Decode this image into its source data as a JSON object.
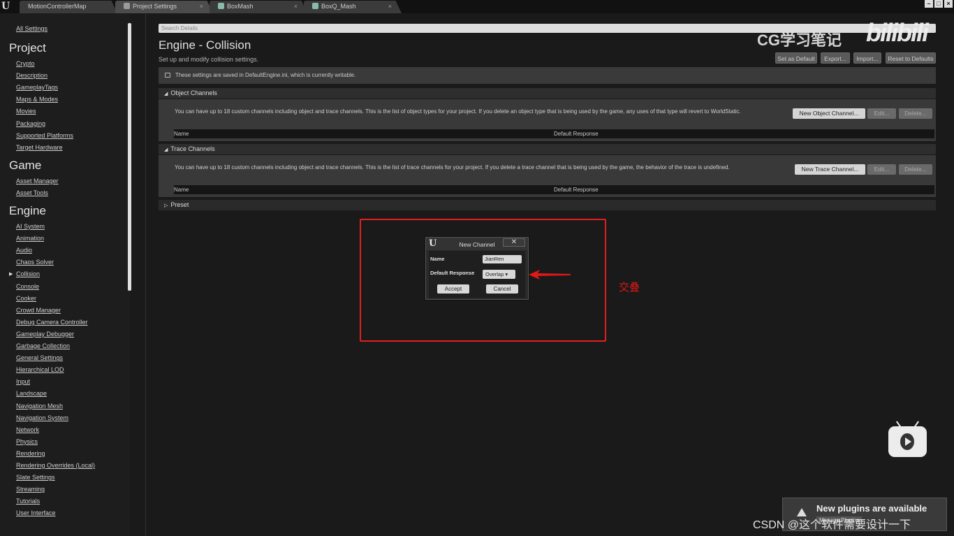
{
  "tabs": [
    {
      "label": "MotionControllerMap",
      "active": false
    },
    {
      "label": "Project Settings",
      "active": true
    },
    {
      "label": "BoxMash",
      "active": false
    },
    {
      "label": "BoxQ_Mash",
      "active": false
    }
  ],
  "window_buttons": [
    "–",
    "□",
    "×"
  ],
  "sidebar": {
    "all_settings": "All Settings",
    "project_heading": "Project",
    "project_items": [
      "Crypto",
      "Description",
      "GameplayTags",
      "Maps & Modes",
      "Movies",
      "Packaging",
      "Supported Platforms",
      "Target Hardware"
    ],
    "game_heading": "Game",
    "game_items": [
      "Asset Manager",
      "Asset Tools"
    ],
    "engine_heading": "Engine",
    "engine_items": [
      "AI System",
      "Animation",
      "Audio",
      "Chaos Solver",
      "Collision",
      "Console",
      "Cooker",
      "Crowd Manager",
      "Debug Camera Controller",
      "Gameplay Debugger",
      "Garbage Collection",
      "General Settings",
      "Hierarchical LOD",
      "Input",
      "Landscape",
      "Navigation Mesh",
      "Navigation System",
      "Network",
      "Physics",
      "Rendering",
      "Rendering Overrides (Local)",
      "Slate Settings",
      "Streaming",
      "Tutorials",
      "User Interface"
    ],
    "selected": "Collision"
  },
  "search": {
    "placeholder": "Search Details"
  },
  "page": {
    "title": "Engine - Collision",
    "subtitle": "Set up and modify collision settings.",
    "buttons": {
      "set_default": "Set as Default",
      "export": "Export...",
      "import": "Import...",
      "reset": "Reset to Defaults"
    },
    "notice": "These settings are saved in DefaultEngine.ini, which is currently writable."
  },
  "object_channels": {
    "title": "Object Channels",
    "description": "You can have up to 18 custom channels including object and trace channels. This is the list of object types for your project. If you delete an object type that is being used by the game, any uses of that type will revert to WorldStatic.",
    "new_button": "New Object Channel...",
    "edit_button": "Edit...",
    "delete_button": "Delete...",
    "col_name": "Name",
    "col_response": "Default Response"
  },
  "trace_channels": {
    "title": "Trace Channels",
    "description": "You can have up to 18 custom channels including object and trace channels. This is the list of trace channels for your project. If you delete a trace channel that is being used by the game, the behavior of the trace is undefined.",
    "new_button": "New Trace Channel...",
    "edit_button": "Edit...",
    "delete_button": "Delete...",
    "col_name": "Name",
    "col_response": "Default Response"
  },
  "preset": {
    "title": "Preset"
  },
  "dialog": {
    "title": "New Channel",
    "close": "✕",
    "name_label": "Name",
    "name_value": "JianRen",
    "response_label": "Default Response",
    "response_value": "Overlap",
    "accept": "Accept",
    "cancel": "Cancel"
  },
  "annotation": {
    "text": "交叠",
    "color": "#e01818"
  },
  "watermark": {
    "left": "CG学习笔记",
    "right": "bilibili"
  },
  "toast": {
    "message": "New plugins are available",
    "manage": "Manage Plugins"
  },
  "footer_watermark": "CSDN @这个软件需要设计一下"
}
